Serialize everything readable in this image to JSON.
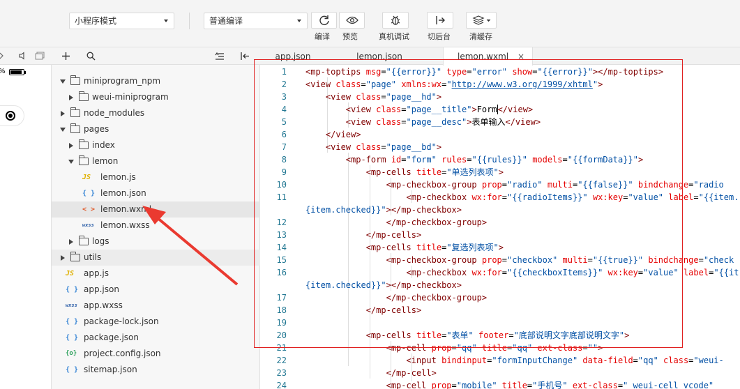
{
  "toolbar": {
    "mode_select": "小程序模式",
    "compile_select": "普通编译",
    "buttons": [
      {
        "label": "编译",
        "icon": "refresh-icon"
      },
      {
        "label": "预览",
        "icon": "eye-icon"
      },
      {
        "label": "真机调试",
        "icon": "bug-icon"
      },
      {
        "label": "切后台",
        "icon": "switch-icon"
      },
      {
        "label": "清缓存",
        "icon": "layers-icon"
      }
    ]
  },
  "simulator": {
    "battery_text": "%"
  },
  "tree": {
    "items": [
      {
        "label": "miniprogram_npm",
        "type": "folder",
        "open": true
      },
      {
        "label": "weui-miniprogram",
        "type": "folder",
        "open": false
      },
      {
        "label": "node_modules",
        "type": "folder",
        "open": false
      },
      {
        "label": "pages",
        "type": "folder",
        "open": true
      },
      {
        "label": "index",
        "type": "folder",
        "open": false
      },
      {
        "label": "lemon",
        "type": "folder",
        "open": true
      },
      {
        "label": "lemon.js",
        "type": "js",
        "icon_text": "JS"
      },
      {
        "label": "lemon.json",
        "type": "json",
        "icon_text": "{ }"
      },
      {
        "label": "lemon.wxml",
        "type": "wxml",
        "icon_text": "< >",
        "selected": true
      },
      {
        "label": "lemon.wxss",
        "type": "wxss",
        "icon_text": "wxss"
      },
      {
        "label": "logs",
        "type": "folder",
        "open": false
      },
      {
        "label": "utils",
        "type": "folder",
        "open": false
      },
      {
        "label": "app.js",
        "type": "js",
        "icon_text": "JS"
      },
      {
        "label": "app.json",
        "type": "json",
        "icon_text": "{ }"
      },
      {
        "label": "app.wxss",
        "type": "wxss",
        "icon_text": "wxss"
      },
      {
        "label": "package-lock.json",
        "type": "json",
        "icon_text": "{ }"
      },
      {
        "label": "package.json",
        "type": "json",
        "icon_text": "{ }"
      },
      {
        "label": "project.config.json",
        "type": "cfg",
        "icon_text": "{o}"
      },
      {
        "label": "sitemap.json",
        "type": "json",
        "icon_text": "{ }"
      }
    ]
  },
  "editor": {
    "tabs": [
      {
        "label": "app.json"
      },
      {
        "label": "lemon.json"
      },
      {
        "label": "lemon.wxml",
        "active": true,
        "close": "×"
      }
    ],
    "lines": [
      {
        "n": "1",
        "html": "<span class=\"tg\">&lt;mp-toptips</span> <span class=\"at\">msg</span>=<span class=\"vl\">\"{{error}}\"</span> <span class=\"at\">type</span>=<span class=\"vl\">\"error\"</span> <span class=\"at\">show</span>=<span class=\"vl\">\"{{error}}\"</span><span class=\"tg\">&gt;&lt;/mp-toptips&gt;</span>"
      },
      {
        "n": "2",
        "html": "<span class=\"tg\">&lt;view</span> <span class=\"at\">class</span>=<span class=\"vl\">\"page\"</span> <span class=\"at\">xmlns:wx</span>=<span class=\"vl\">\"<span class=\"lk\">http://www.w3.org/1999/xhtml</span>\"</span><span class=\"tg\">&gt;</span>"
      },
      {
        "n": "3",
        "html": "    <span class=\"tg\">&lt;view</span> <span class=\"at\">class</span>=<span class=\"vl\">\"page__hd\"</span><span class=\"tg\">&gt;</span>"
      },
      {
        "n": "4",
        "html": "        <span class=\"tg\">&lt;view</span> <span class=\"at\">class</span>=<span class=\"vl\">\"page__title\"</span><span class=\"tg\">&gt;</span><span class=\"tx\">Form</span><span class=\"tg cursor\">&lt;/view&gt;</span>"
      },
      {
        "n": "5",
        "html": "        <span class=\"tg\">&lt;view</span> <span class=\"at\">class</span>=<span class=\"vl\">\"page__desc\"</span><span class=\"tg\">&gt;</span><span class=\"tx\">表单输入</span><span class=\"tg\">&lt;/view&gt;</span>"
      },
      {
        "n": "6",
        "html": "    <span class=\"tg\">&lt;/view&gt;</span>"
      },
      {
        "n": "7",
        "html": "    <span class=\"tg\">&lt;view</span> <span class=\"at\">class</span>=<span class=\"vl\">\"page__bd\"</span><span class=\"tg\">&gt;</span>"
      },
      {
        "n": "8",
        "html": "        <span class=\"tg\">&lt;mp-form</span> <span class=\"at\">id</span>=<span class=\"vl\">\"form\"</span> <span class=\"at\">rules</span>=<span class=\"vl\">\"{{rules}}\"</span> <span class=\"at\">models</span>=<span class=\"vl\">\"{{formData}}\"</span><span class=\"tg\">&gt;</span>"
      },
      {
        "n": "9",
        "html": "            <span class=\"tg\">&lt;mp-cells</span> <span class=\"at\">title</span>=<span class=\"vl\">\"单选列表项\"</span><span class=\"tg\">&gt;</span>"
      },
      {
        "n": "10",
        "html": "                <span class=\"tg\">&lt;mp-checkbox-group</span> <span class=\"at\">prop</span>=<span class=\"vl\">\"radio\"</span> <span class=\"at\">multi</span>=<span class=\"vl\">\"{{false}}\"</span> <span class=\"at\">bindchange</span>=<span class=\"vl\">\"radio</span>"
      },
      {
        "n": "11",
        "html": "                    <span class=\"tg\">&lt;mp-checkbox</span> <span class=\"at\">wx:for</span>=<span class=\"vl\">\"{{radioItems}}\"</span> <span class=\"at\">wx:key</span>=<span class=\"vl\">\"value\"</span> <span class=\"at\">label</span>=<span class=\"vl\">\"{{item.</span>"
      },
      {
        "n": "",
        "html": "<span class=\"vl\">{item.checked}}\"</span><span class=\"tg\">&gt;&lt;/mp-checkbox&gt;</span>"
      },
      {
        "n": "12",
        "html": "                <span class=\"tg\">&lt;/mp-checkbox-group&gt;</span>"
      },
      {
        "n": "13",
        "html": "            <span class=\"tg\">&lt;/mp-cells&gt;</span>"
      },
      {
        "n": "14",
        "html": "            <span class=\"tg\">&lt;mp-cells</span> <span class=\"at\">title</span>=<span class=\"vl\">\"复选列表项\"</span><span class=\"tg\">&gt;</span>"
      },
      {
        "n": "15",
        "html": "                <span class=\"tg\">&lt;mp-checkbox-group</span> <span class=\"at\">prop</span>=<span class=\"vl\">\"checkbox\"</span> <span class=\"at\">multi</span>=<span class=\"vl\">\"{{true}}\"</span> <span class=\"at\">bindchange</span>=<span class=\"vl\">\"check</span>"
      },
      {
        "n": "16",
        "html": "                    <span class=\"tg\">&lt;mp-checkbox</span> <span class=\"at\">wx:for</span>=<span class=\"vl\">\"{{checkboxItems}}\"</span> <span class=\"at\">wx:key</span>=<span class=\"vl\">\"value\"</span> <span class=\"at\">label</span>=<span class=\"vl\">\"{{it</span>"
      },
      {
        "n": "",
        "html": "<span class=\"vl\">{item.checked}}\"</span><span class=\"tg\">&gt;&lt;/mp-checkbox&gt;</span>"
      },
      {
        "n": "17",
        "html": "                <span class=\"tg\">&lt;/mp-checkbox-group&gt;</span>"
      },
      {
        "n": "18",
        "html": "            <span class=\"tg\">&lt;/mp-cells&gt;</span>"
      },
      {
        "n": "19",
        "html": ""
      },
      {
        "n": "20",
        "html": "            <span class=\"tg\">&lt;mp-cells</span> <span class=\"at\">title</span>=<span class=\"vl\">\"表单\"</span> <span class=\"at\">footer</span>=<span class=\"vl\">\"底部说明文字底部说明文字\"</span><span class=\"tg\">&gt;</span>"
      },
      {
        "n": "21",
        "html": "                <span class=\"tg\">&lt;mp-cell</span> <span class=\"at\">prop</span>=<span class=\"vl\">\"qq\"</span> <span class=\"at\">title</span>=<span class=\"vl\">\"qq\"</span> <span class=\"at\">ext-class</span>=<span class=\"vl\">\"\"</span><span class=\"tg\">&gt;</span>"
      },
      {
        "n": "22",
        "html": "                    <span class=\"tg\">&lt;input</span> <span class=\"at\">bindinput</span>=<span class=\"vl\">\"formInputChange\"</span> <span class=\"at\">data-field</span>=<span class=\"vl\">\"qq\"</span> <span class=\"at\">class</span>=<span class=\"vl\">\"weui-</span>"
      },
      {
        "n": "23",
        "html": "                <span class=\"tg\">&lt;/mp-cell&gt;</span>"
      },
      {
        "n": "24",
        "html": "                <span class=\"tg\">&lt;mp-cell</span> <span class=\"at\">prop</span>=<span class=\"vl\">\"mobile\"</span> <span class=\"at\">title</span>=<span class=\"vl\">\"手机号\"</span> <span class=\"at\">ext-class</span>=<span class=\"vl\">\" weui-cell_vcode\"</span>"
      }
    ]
  }
}
